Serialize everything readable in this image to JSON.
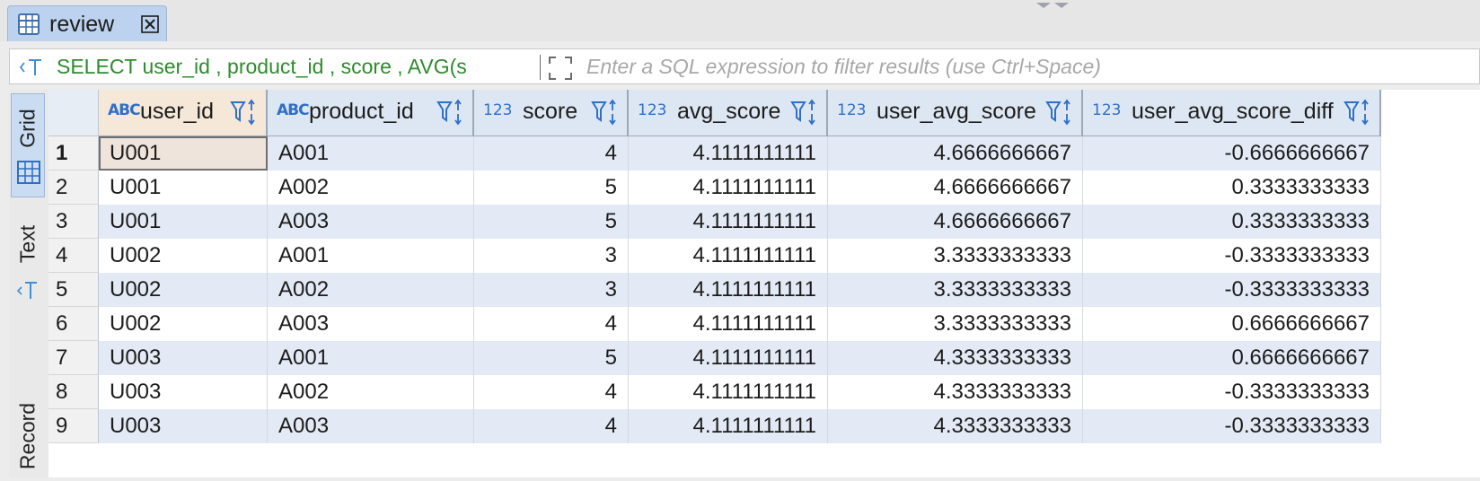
{
  "tab": {
    "label": "review"
  },
  "filter": {
    "sql_text": "SELECT user_id , product_id , score , AVG(s",
    "placeholder": "Enter a SQL expression to filter results (use Ctrl+Space)"
  },
  "side_tabs": [
    {
      "label": "Grid",
      "icon": "grid-icon",
      "active": true
    },
    {
      "label": "Text",
      "icon": "text-icon",
      "active": false
    },
    {
      "label": "Record",
      "icon": "",
      "active": false
    }
  ],
  "columns": [
    {
      "type": "ABC",
      "name": "user_id",
      "numeric": false
    },
    {
      "type": "ABC",
      "name": "product_id",
      "numeric": false
    },
    {
      "type": "123",
      "name": "score",
      "numeric": true
    },
    {
      "type": "123",
      "name": "avg_score",
      "numeric": true
    },
    {
      "type": "123",
      "name": "user_avg_score",
      "numeric": true
    },
    {
      "type": "123",
      "name": "user_avg_score_diff",
      "numeric": true
    }
  ],
  "rows": [
    [
      "1",
      "U001",
      "A001",
      "4",
      "4.1111111111",
      "4.6666666667",
      "-0.6666666667"
    ],
    [
      "2",
      "U001",
      "A002",
      "5",
      "4.1111111111",
      "4.6666666667",
      "0.3333333333"
    ],
    [
      "3",
      "U001",
      "A003",
      "5",
      "4.1111111111",
      "4.6666666667",
      "0.3333333333"
    ],
    [
      "4",
      "U002",
      "A001",
      "3",
      "4.1111111111",
      "3.3333333333",
      "-0.3333333333"
    ],
    [
      "5",
      "U002",
      "A002",
      "3",
      "4.1111111111",
      "3.3333333333",
      "-0.3333333333"
    ],
    [
      "6",
      "U002",
      "A003",
      "4",
      "4.1111111111",
      "3.3333333333",
      "0.6666666667"
    ],
    [
      "7",
      "U003",
      "A001",
      "5",
      "4.1111111111",
      "4.3333333333",
      "0.6666666667"
    ],
    [
      "8",
      "U003",
      "A002",
      "4",
      "4.1111111111",
      "4.3333333333",
      "-0.3333333333"
    ],
    [
      "9",
      "U003",
      "A003",
      "4",
      "4.1111111111",
      "4.3333333333",
      "-0.3333333333"
    ]
  ],
  "colors": {
    "header_bg": "#dde7f3",
    "alt_row": "#e3eaf5",
    "sql_green": "#2d8c2d",
    "type_blue": "#2f6fc6"
  }
}
